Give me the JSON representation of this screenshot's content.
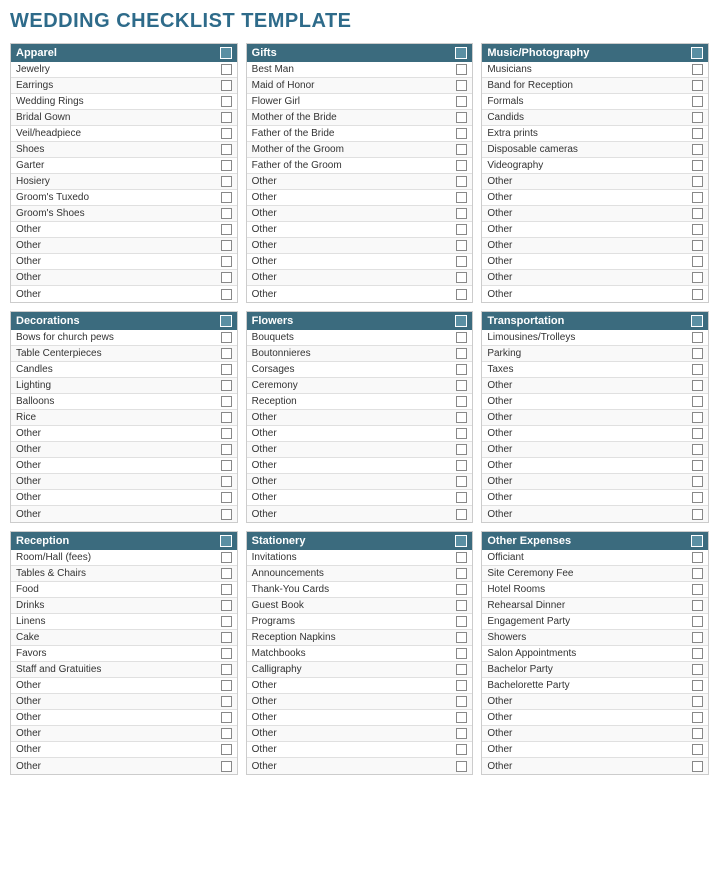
{
  "title": "WEDDING CHECKLIST TEMPLATE",
  "sections": [
    {
      "id": "apparel",
      "header": "Apparel",
      "items": [
        "Jewelry",
        "Earrings",
        "Wedding Rings",
        "Bridal Gown",
        "Veil/headpiece",
        "Shoes",
        "Garter",
        "Hosiery",
        "Groom's Tuxedo",
        "Groom's Shoes",
        "Other",
        "Other",
        "Other",
        "Other",
        "Other"
      ]
    },
    {
      "id": "gifts",
      "header": "Gifts",
      "items": [
        "Best Man",
        "Maid of Honor",
        "Flower Girl",
        "Mother of the Bride",
        "Father of the Bride",
        "Mother of the Groom",
        "Father of the Groom",
        "Other",
        "Other",
        "Other",
        "Other",
        "Other",
        "Other",
        "Other",
        "Other"
      ]
    },
    {
      "id": "music-photography",
      "header": "Music/Photography",
      "items": [
        "Musicians",
        "Band for Reception",
        "Formals",
        "Candids",
        "Extra prints",
        "Disposable cameras",
        "Videography",
        "Other",
        "Other",
        "Other",
        "Other",
        "Other",
        "Other",
        "Other",
        "Other"
      ]
    },
    {
      "id": "decorations",
      "header": "Decorations",
      "items": [
        "Bows for church pews",
        "Table Centerpieces",
        "Candles",
        "Lighting",
        "Balloons",
        "Rice",
        "Other",
        "Other",
        "Other",
        "Other",
        "Other",
        "Other"
      ]
    },
    {
      "id": "flowers",
      "header": "Flowers",
      "items": [
        "Bouquets",
        "Boutonnieres",
        "Corsages",
        "Ceremony",
        "Reception",
        "Other",
        "Other",
        "Other",
        "Other",
        "Other",
        "Other",
        "Other"
      ]
    },
    {
      "id": "transportation",
      "header": "Transportation",
      "items": [
        "Limousines/Trolleys",
        "Parking",
        "Taxes",
        "Other",
        "Other",
        "Other",
        "Other",
        "Other",
        "Other",
        "Other",
        "Other",
        "Other"
      ]
    },
    {
      "id": "reception",
      "header": "Reception",
      "items": [
        "Room/Hall (fees)",
        "Tables & Chairs",
        "Food",
        "Drinks",
        "Linens",
        "Cake",
        "Favors",
        "Staff and Gratuities",
        "Other",
        "Other",
        "Other",
        "Other",
        "Other",
        "Other"
      ]
    },
    {
      "id": "stationery",
      "header": "Stationery",
      "items": [
        "Invitations",
        "Announcements",
        "Thank-You Cards",
        "Guest Book",
        "Programs",
        "Reception Napkins",
        "Matchbooks",
        "Calligraphy",
        "Other",
        "Other",
        "Other",
        "Other",
        "Other",
        "Other"
      ]
    },
    {
      "id": "other-expenses",
      "header": "Other Expenses",
      "items": [
        "Officiant",
        "Site Ceremony Fee",
        "Hotel Rooms",
        "Rehearsal Dinner",
        "Engagement Party",
        "Showers",
        "Salon Appointments",
        "Bachelor Party",
        "Bachelorette Party",
        "Other",
        "Other",
        "Other",
        "Other",
        "Other"
      ]
    }
  ]
}
